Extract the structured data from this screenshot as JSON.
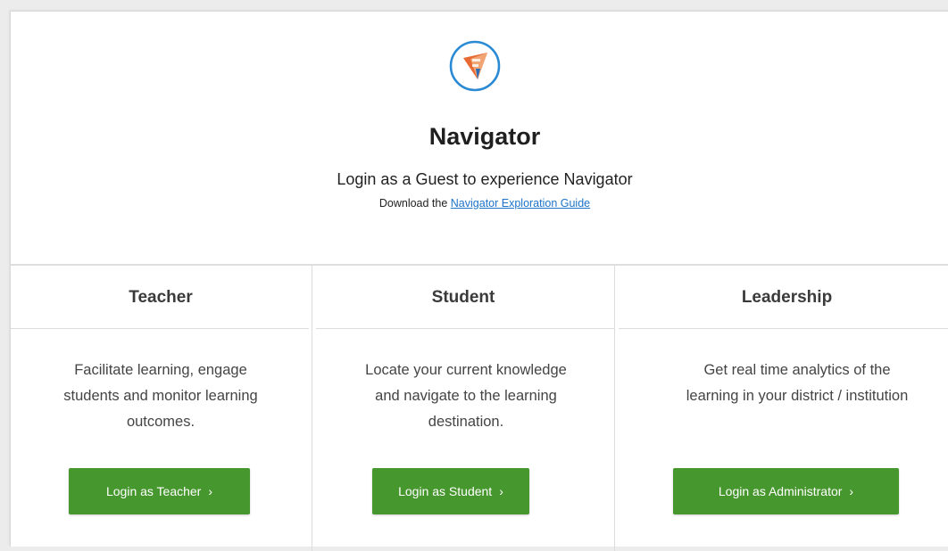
{
  "header": {
    "title": "Navigator",
    "subtitle": "Login as a Guest to experience Navigator",
    "download_prefix": "Download the ",
    "download_link": "Navigator Exploration Guide"
  },
  "colors": {
    "accent_green": "#47972f",
    "link_blue": "#1d73c8",
    "logo_ring": "#2b8ad4",
    "logo_orange": "#e86a33"
  },
  "roles": [
    {
      "title": "Teacher",
      "description": "Facilitate learning, engage students and monitor learning outcomes.",
      "button_label": "Login as Teacher",
      "button_icon": "chevron-right-icon"
    },
    {
      "title": "Student",
      "description": "Locate your current knowledge and navigate to the learning destination.",
      "button_label": "Login as Student",
      "button_icon": "chevron-right-icon"
    },
    {
      "title": "Leadership",
      "description": "Get real time analytics of the learning in your district / institution",
      "button_label": "Login as Administrator",
      "button_icon": "chevron-right-icon"
    }
  ]
}
